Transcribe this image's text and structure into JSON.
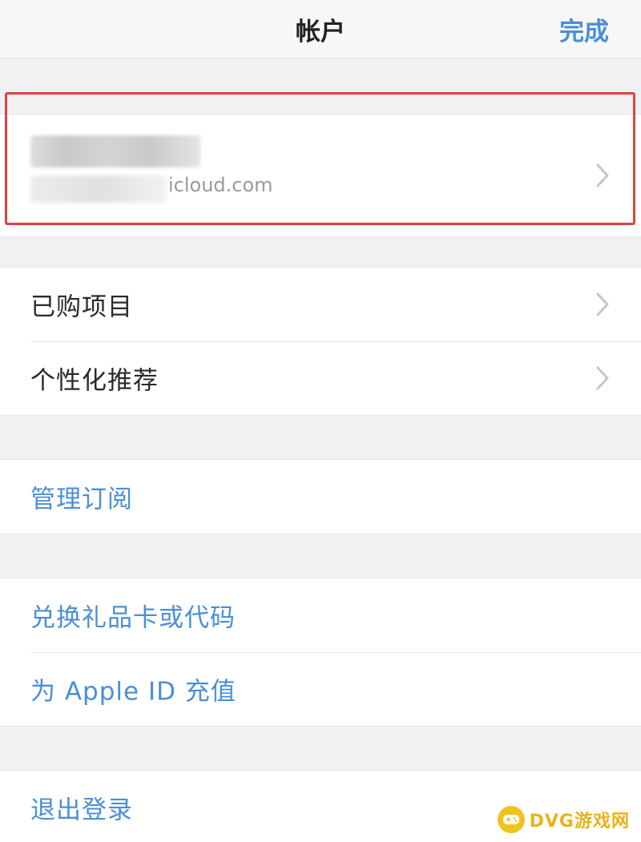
{
  "navbar": {
    "title": "帐户",
    "done_label": "完成"
  },
  "account": {
    "email_suffix": "icloud.com"
  },
  "group1": {
    "items": [
      {
        "label": "已购项目"
      },
      {
        "label": "个性化推荐"
      }
    ]
  },
  "group2": {
    "items": [
      {
        "label": "管理订阅"
      }
    ]
  },
  "group3": {
    "items": [
      {
        "label": "兑换礼品卡或代码"
      },
      {
        "label": "为 Apple ID 充值"
      }
    ]
  },
  "group4": {
    "items": [
      {
        "label": "退出登录"
      }
    ]
  },
  "watermark": {
    "text": "DVG游戏网"
  },
  "icons": {
    "chevron": "chevron-right-icon",
    "watermark_logo": "gamepad-icon"
  },
  "colors": {
    "link_blue": "#4a8fd6",
    "highlight_red": "#e0413f",
    "watermark_yellow": "#f1c21b"
  }
}
